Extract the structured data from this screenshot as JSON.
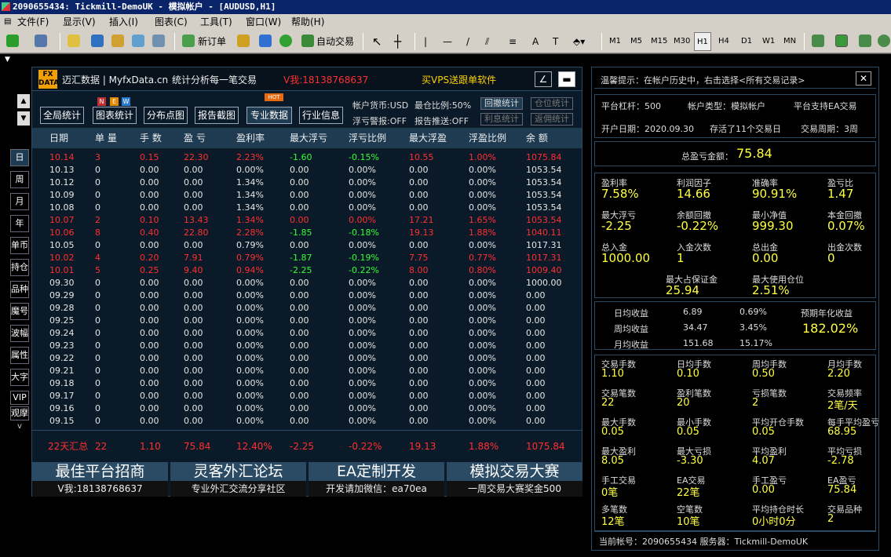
{
  "window": {
    "title": "2090655434: Tickmill-DemoUK - 模拟帐户 - [AUDUSD,H1]"
  },
  "menu": [
    "文件(F)",
    "显示(V)",
    "插入(I)",
    "图表(C)",
    "工具(T)",
    "窗口(W)",
    "帮助(H)"
  ],
  "toolbar": {
    "new_order": "新订单",
    "auto_trade": "自动交易",
    "periods": [
      "M1",
      "M5",
      "M15",
      "M30",
      "H1",
      "H4",
      "D1",
      "W1",
      "MN"
    ],
    "active_period": "H1",
    "text_tool": "A"
  },
  "header": {
    "logo_top": "FX",
    "logo_bottom": "DATA",
    "brand": "迈汇数据 | MyfxData.cn",
    "slogan": "统计分析每一笔交易",
    "contact": "V我:18138768637",
    "vps": "买VPS送跟单软件",
    "minimize_icon": "∠",
    "close_icon": "▬"
  },
  "buttons": {
    "all_stats": "全局统计",
    "chart_stats": "图表统计",
    "dist_chart": "分布点图",
    "report_shot": "报告截图",
    "pro_data": "专业数据",
    "industry_info": "行业信息",
    "new_badge": [
      "N",
      "E",
      "W"
    ],
    "hot_badge": "HOT"
  },
  "account_info": {
    "currency": "帐户货币:USD",
    "max_pos": "最仓比例:50%",
    "float_warn": "浮亏警报:OFF",
    "report_push": "报告推送:OFF",
    "btn_drawdown": "回撤统计",
    "btn_position": "仓位统计",
    "btn_interest": "利息统计",
    "btn_rebate": "返佣统计"
  },
  "side_tabs": [
    "日",
    "周",
    "月",
    "年",
    "单币",
    "持仓",
    "品种",
    "魔号",
    "波幅",
    "属性",
    "大字",
    "VIP",
    "观摩"
  ],
  "side_arrows": {
    "up": "▲",
    "down": "▼",
    "more": "v"
  },
  "table": {
    "columns": [
      "日期",
      "单 量",
      "手 数",
      "盈 亏",
      "盈利率",
      "最大浮亏",
      "浮亏比例",
      "最大浮盈",
      "浮盈比例",
      "余 额"
    ],
    "rows": [
      [
        "10.14",
        "3",
        "0.15",
        "22.30",
        "2.23%",
        "-1.60",
        "-0.15%",
        "10.55",
        "1.00%",
        "1075.84",
        "r"
      ],
      [
        "10.13",
        "0",
        "0.00",
        "0.00",
        "0.00%",
        "0.00",
        "0.00%",
        "0.00",
        "0.00%",
        "1053.54",
        "w"
      ],
      [
        "10.12",
        "0",
        "0.00",
        "0.00",
        "1.34%",
        "0.00",
        "0.00%",
        "0.00",
        "0.00%",
        "1053.54",
        "w"
      ],
      [
        "10.09",
        "0",
        "0.00",
        "0.00",
        "1.34%",
        "0.00",
        "0.00%",
        "0.00",
        "0.00%",
        "1053.54",
        "w"
      ],
      [
        "10.08",
        "0",
        "0.00",
        "0.00",
        "1.34%",
        "0.00",
        "0.00%",
        "0.00",
        "0.00%",
        "1053.54",
        "w"
      ],
      [
        "10.07",
        "2",
        "0.10",
        "13.43",
        "1.34%",
        "0.00",
        "0.00%",
        "17.21",
        "1.65%",
        "1053.54",
        "r"
      ],
      [
        "10.06",
        "8",
        "0.40",
        "22.80",
        "2.28%",
        "-1.85",
        "-0.18%",
        "19.13",
        "1.88%",
        "1040.11",
        "r"
      ],
      [
        "10.05",
        "0",
        "0.00",
        "0.00",
        "0.79%",
        "0.00",
        "0.00%",
        "0.00",
        "0.00%",
        "1017.31",
        "w"
      ],
      [
        "10.02",
        "4",
        "0.20",
        "7.91",
        "0.79%",
        "-1.87",
        "-0.19%",
        "7.75",
        "0.77%",
        "1017.31",
        "r"
      ],
      [
        "10.01",
        "5",
        "0.25",
        "9.40",
        "0.94%",
        "-2.25",
        "-0.22%",
        "8.00",
        "0.80%",
        "1009.40",
        "r"
      ],
      [
        "09.30",
        "0",
        "0.00",
        "0.00",
        "0.00%",
        "0.00",
        "0.00%",
        "0.00",
        "0.00%",
        "1000.00",
        "w"
      ],
      [
        "09.29",
        "0",
        "0.00",
        "0.00",
        "0.00%",
        "0.00",
        "0.00%",
        "0.00",
        "0.00%",
        "0.00",
        "w"
      ],
      [
        "09.28",
        "0",
        "0.00",
        "0.00",
        "0.00%",
        "0.00",
        "0.00%",
        "0.00",
        "0.00%",
        "0.00",
        "w"
      ],
      [
        "09.25",
        "0",
        "0.00",
        "0.00",
        "0.00%",
        "0.00",
        "0.00%",
        "0.00",
        "0.00%",
        "0.00",
        "w"
      ],
      [
        "09.24",
        "0",
        "0.00",
        "0.00",
        "0.00%",
        "0.00",
        "0.00%",
        "0.00",
        "0.00%",
        "0.00",
        "w"
      ],
      [
        "09.23",
        "0",
        "0.00",
        "0.00",
        "0.00%",
        "0.00",
        "0.00%",
        "0.00",
        "0.00%",
        "0.00",
        "w"
      ],
      [
        "09.22",
        "0",
        "0.00",
        "0.00",
        "0.00%",
        "0.00",
        "0.00%",
        "0.00",
        "0.00%",
        "0.00",
        "w"
      ],
      [
        "09.21",
        "0",
        "0.00",
        "0.00",
        "0.00%",
        "0.00",
        "0.00%",
        "0.00",
        "0.00%",
        "0.00",
        "w"
      ],
      [
        "09.18",
        "0",
        "0.00",
        "0.00",
        "0.00%",
        "0.00",
        "0.00%",
        "0.00",
        "0.00%",
        "0.00",
        "w"
      ],
      [
        "09.17",
        "0",
        "0.00",
        "0.00",
        "0.00%",
        "0.00",
        "0.00%",
        "0.00",
        "0.00%",
        "0.00",
        "w"
      ],
      [
        "09.16",
        "0",
        "0.00",
        "0.00",
        "0.00%",
        "0.00",
        "0.00%",
        "0.00",
        "0.00%",
        "0.00",
        "w"
      ],
      [
        "09.15",
        "0",
        "0.00",
        "0.00",
        "0.00%",
        "0.00",
        "0.00%",
        "0.00",
        "0.00%",
        "0.00",
        "w"
      ]
    ],
    "summary": [
      "22天汇总",
      "22",
      "1.10",
      "75.84",
      "12.40%",
      "-2.25",
      "-0.22%",
      "19.13",
      "1.88%",
      "1075.84"
    ]
  },
  "banners": [
    {
      "title": "最佳平台招商",
      "sub": "V我:18138768637"
    },
    {
      "title": "灵客外汇论坛",
      "sub": "专业外汇交流分享社区"
    },
    {
      "title": "EA定制开发",
      "sub": "开发请加微信：ea70ea"
    },
    {
      "title": "模拟交易大赛",
      "sub": "一周交易大赛奖金500"
    }
  ],
  "right": {
    "tip": "温馨提示：在帐户历史中，右击选择<所有交易记录>",
    "close_icon": "✕",
    "leverage": "平台杠杆：500",
    "acct_type": "帐户类型：模拟帐户",
    "ea_support": "平台支持EA交易",
    "open_date": "开户日期：2020.09.30",
    "saved": "存活了11个交易日",
    "cycle": "交易周期：3周",
    "total_pl_label": "总盈亏金额：",
    "total_pl": "75.84",
    "grid1": [
      [
        "盈利率",
        "7.58%"
      ],
      [
        "利润因子",
        "14.66"
      ],
      [
        "准确率",
        "90.91%"
      ],
      [
        "盈亏比",
        "1.47"
      ],
      [
        "最大浮亏",
        "-2.25"
      ],
      [
        "余额回撤",
        "-0.22%"
      ],
      [
        "最小净值",
        "999.30"
      ],
      [
        "本金回撤",
        "0.07%"
      ],
      [
        "总入金",
        "1000.00"
      ],
      [
        "入金次数",
        "1"
      ],
      [
        "总出金",
        "0.00"
      ],
      [
        "出金次数",
        "0"
      ]
    ],
    "margin": [
      [
        "最大占保证金",
        "25.94"
      ],
      [
        "最大使用仓位",
        "2.51%"
      ]
    ],
    "income": [
      [
        "日均收益",
        "6.89",
        "0.69%"
      ],
      [
        "周均收益",
        "34.47",
        "3.45%"
      ],
      [
        "月均收益",
        "151.68",
        "15.17%"
      ]
    ],
    "annual_label": "预期年化收益",
    "annual": "182.02%",
    "grid2": [
      [
        "交易手数",
        "1.10"
      ],
      [
        "日均手数",
        "0.10"
      ],
      [
        "周均手数",
        "0.50"
      ],
      [
        "月均手数",
        "2.20"
      ],
      [
        "交易笔数",
        "22"
      ],
      [
        "盈利笔数",
        "20"
      ],
      [
        "亏损笔数",
        "2"
      ],
      [
        "交易频率",
        "2笔/天"
      ],
      [
        "最大手数",
        "0.05"
      ],
      [
        "最小手数",
        "0.05"
      ],
      [
        "平均开仓手数",
        "0.05"
      ],
      [
        "每手平均盈亏",
        "68.95"
      ],
      [
        "最大盈利",
        "8.05"
      ],
      [
        "最大亏损",
        "-3.30"
      ],
      [
        "平均盈利",
        "4.07"
      ],
      [
        "平均亏损",
        "-2.78"
      ],
      [
        "手工交易",
        "0笔"
      ],
      [
        "EA交易",
        "22笔"
      ],
      [
        "手工盈亏",
        "0.00"
      ],
      [
        "EA盈亏",
        "75.84"
      ],
      [
        "多笔数",
        "12笔"
      ],
      [
        "空笔数",
        "10笔"
      ],
      [
        "平均持仓时长",
        "0小时0分"
      ],
      [
        "交易品种",
        "2"
      ]
    ],
    "footer": "当前帐号：2090655434   服务器：Tickmill-DemoUK"
  },
  "colors": {
    "profit": "#ff3030",
    "loss": "#33ff33",
    "value": "#ffff40",
    "panel": "#0b1a28",
    "header": "#1e3b52"
  }
}
